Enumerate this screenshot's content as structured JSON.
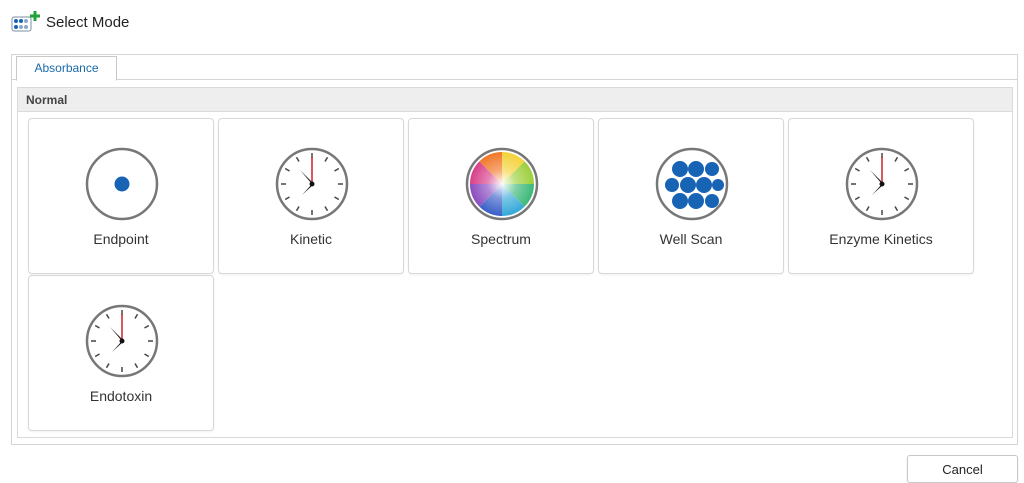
{
  "window": {
    "title": "Select Mode",
    "icon": "plate-plus-icon"
  },
  "tabs": [
    {
      "label": "Absorbance",
      "active": true
    }
  ],
  "section": {
    "title": "Normal"
  },
  "modes": [
    {
      "label": "Endpoint",
      "icon": "endpoint-icon"
    },
    {
      "label": "Kinetic",
      "icon": "clock-icon"
    },
    {
      "label": "Spectrum",
      "icon": "spectrum-icon"
    },
    {
      "label": "Well Scan",
      "icon": "well-scan-icon"
    },
    {
      "label": "Enzyme Kinetics",
      "icon": "clock-icon"
    },
    {
      "label": "Endotoxin",
      "icon": "clock-icon"
    }
  ],
  "buttons": {
    "cancel": "Cancel"
  },
  "colors": {
    "accent": "#1a6aa8",
    "well_blue": "#1763b4",
    "clock_red": "#d0202a"
  }
}
